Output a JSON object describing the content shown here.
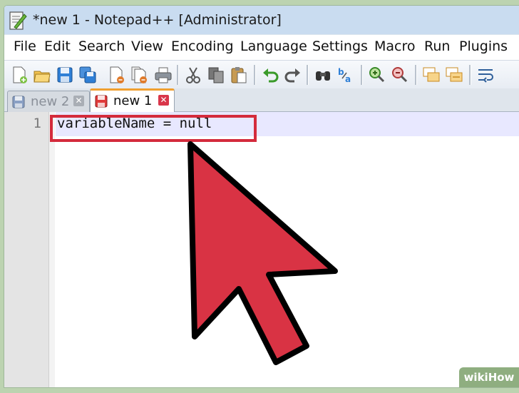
{
  "window": {
    "title": "*new 1 - Notepad++ [Administrator]"
  },
  "menu": {
    "items": [
      "File",
      "Edit",
      "Search",
      "View",
      "Encoding",
      "Language",
      "Settings",
      "Macro",
      "Run",
      "Plugins"
    ]
  },
  "toolbar": {
    "icons": [
      "new-file-icon",
      "open-file-icon",
      "save-icon",
      "save-all-icon",
      "close-icon",
      "close-all-icon",
      "print-icon",
      "cut-icon",
      "copy-icon",
      "paste-icon",
      "undo-icon",
      "redo-icon",
      "find-icon",
      "replace-icon",
      "zoom-in-icon",
      "zoom-out-icon",
      "sync-vertical-icon",
      "sync-horizontal-icon",
      "word-wrap-icon"
    ]
  },
  "tabs": [
    {
      "label": "new 2",
      "active": false
    },
    {
      "label": "new 1",
      "active": true
    }
  ],
  "editor": {
    "line_number": "1",
    "code_line": "variableName = null"
  },
  "watermark": {
    "text": "wikiHow"
  },
  "colors": {
    "highlight": "#d42b3c",
    "arrow": "#d93344",
    "titlebar": "#c9dcf0",
    "active_tab_accent": "#f0a030"
  }
}
